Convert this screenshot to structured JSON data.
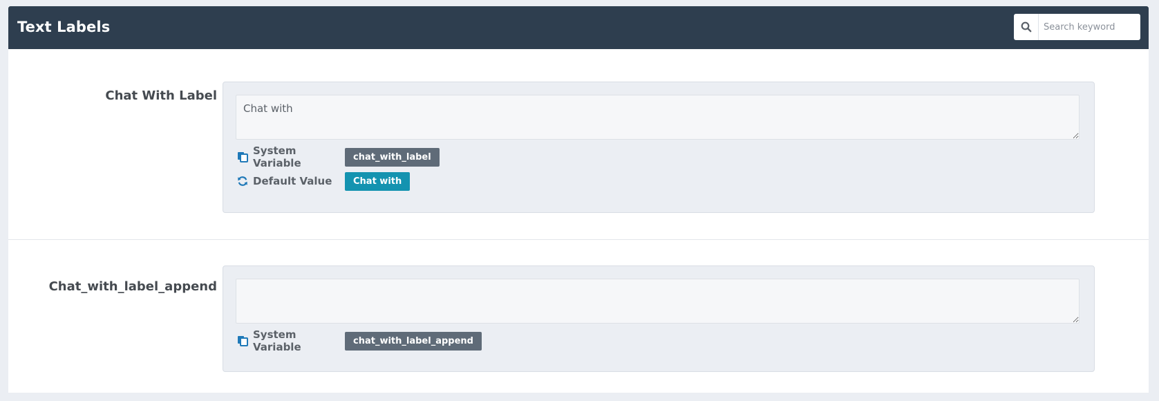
{
  "header": {
    "title": "Text Labels",
    "search": {
      "placeholder": "Search keyword",
      "value": ""
    }
  },
  "colors": {
    "header_bg": "#2e3e4f",
    "variable_tag": "#5f6b78",
    "default_tag": "#1493b0",
    "icon_accent": "#1f79b8"
  },
  "fields": [
    {
      "label": "Chat With Label",
      "value": "Chat with",
      "system_variable_label": "System Variable",
      "system_variable": "chat_with_label",
      "default_value_label": "Default Value",
      "default_value": "Chat with"
    },
    {
      "label": "Chat_with_label_append",
      "value": "",
      "system_variable_label": "System Variable",
      "system_variable": "chat_with_label_append"
    }
  ]
}
